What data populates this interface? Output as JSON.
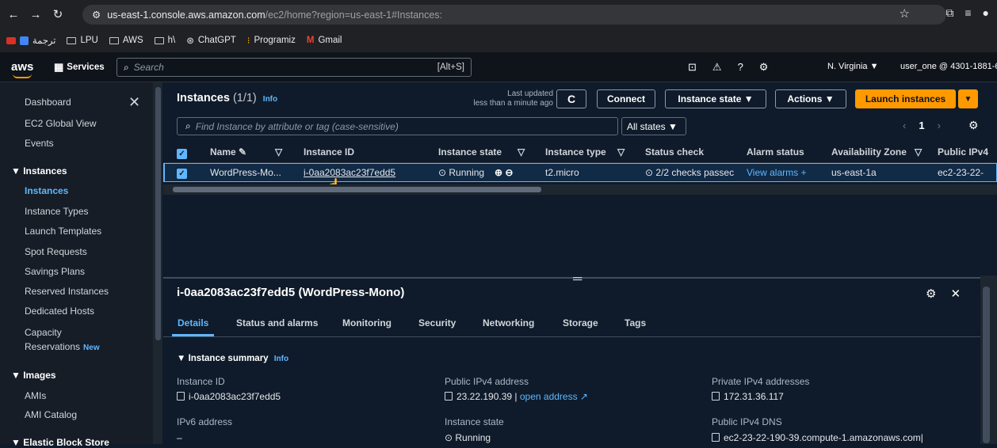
{
  "browser": {
    "url_host": "us-east-1.console.aws.amazon.com",
    "url_path": "/ec2/home?region=us-east-1#Instances:",
    "bookmarks": [
      "ترجمة",
      "LPU",
      "AWS",
      "h\\",
      "ChatGPT",
      "Programiz",
      "Gmail"
    ]
  },
  "aws": {
    "logo": "aws",
    "services": "Services",
    "search_placeholder": "Search",
    "search_hint": "[Alt+S]",
    "region": "N. Virginia ▼",
    "account": "user_one @ 4301-1881-6"
  },
  "sidebar": {
    "dashboard": "Dashboard",
    "global_view": "EC2 Global View",
    "events": "Events",
    "instances_header": "▼ Instances",
    "items": [
      "Instances",
      "Instance Types",
      "Launch Templates",
      "Spot Requests",
      "Savings Plans",
      "Reserved Instances",
      "Dedicated Hosts"
    ],
    "capacity_1": "Capacity",
    "capacity_2": "Reservations",
    "new_badge": "New",
    "images_header": "▼ Images",
    "image_items": [
      "AMIs",
      "AMI Catalog"
    ],
    "ebs_header": "▼ Elastic Block Store"
  },
  "instances_panel": {
    "title": "Instances",
    "count": "(1/1)",
    "info": "Info",
    "last_updated_1": "Last updated",
    "last_updated_2": "less than a minute ago",
    "refresh": "C",
    "connect": "Connect",
    "instance_state": "Instance state ▼",
    "actions": "Actions ▼",
    "launch": "Launch instances",
    "launch_caret": "▼",
    "filter_placeholder": "Find Instance by attribute or tag (case-sensitive)",
    "state_filter": "All states ▼",
    "page": "1",
    "columns": [
      "Name ✎",
      "▽",
      "Instance ID",
      "Instance state",
      "▽",
      "Instance type",
      "▽",
      "Status check",
      "Alarm status",
      "Availability Zone",
      "▽",
      "Public IPv4"
    ],
    "row": {
      "name": "WordPress-Mo...",
      "id": "i-0aa2083ac23f7edd5",
      "state": "⊙ Running",
      "zoom": "⊕ ⊖",
      "type": "t2.micro",
      "status": "⊙ 2/2 checks passec",
      "alarm": "View alarms +",
      "az": "us-east-1a",
      "ipv4": "ec2-23-22-"
    }
  },
  "details": {
    "title": "i-0aa2083ac23f7edd5 (WordPress-Mono)",
    "tabs": [
      "Details",
      "Status and alarms",
      "Monitoring",
      "Security",
      "Networking",
      "Storage",
      "Tags"
    ],
    "summary": "▼ Instance summary",
    "info": "Info",
    "fields": {
      "instance_id_label": "Instance ID",
      "instance_id": "i-0aa2083ac23f7edd5",
      "ipv6_label": "IPv6 address",
      "ipv6": "–",
      "public_ipv4_label": "Public IPv4 address",
      "public_ipv4": "23.22.190.39 |",
      "open_address": "open address ↗",
      "state_label": "Instance state",
      "state": "⊙ Running",
      "private_ipv4_label": "Private IPv4 addresses",
      "private_ipv4": "172.31.36.117",
      "public_dns_label": "Public IPv4 DNS",
      "public_dns": "ec2-23-22-190-39.compute-1.amazonaws.com|"
    }
  }
}
